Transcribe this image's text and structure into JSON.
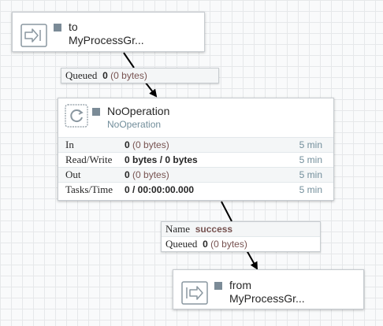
{
  "input_port": {
    "name_line1": "to",
    "name_line2": "MyProcessGr..."
  },
  "connection1": {
    "queued_label": "Queued",
    "queued_count": "0",
    "queued_size": "(0 bytes)"
  },
  "processor": {
    "name": "NoOperation",
    "type": "NoOperation",
    "stats": [
      {
        "label": "In",
        "value": "0",
        "extra": "(0 bytes)",
        "time": "5 min"
      },
      {
        "label": "Read/Write",
        "value": "0 bytes / 0 bytes",
        "extra": "",
        "time": "5 min"
      },
      {
        "label": "Out",
        "value": "0",
        "extra": "(0 bytes)",
        "time": "5 min"
      },
      {
        "label": "Tasks/Time",
        "value": "0 / 00:00:00.000",
        "extra": "",
        "time": "5 min"
      }
    ]
  },
  "connection2": {
    "name_label": "Name",
    "name_value": "success",
    "queued_label": "Queued",
    "queued_count": "0",
    "queued_size": "(0 bytes)"
  },
  "output_port": {
    "name_line1": "from",
    "name_line2": "MyProcessGr..."
  }
}
